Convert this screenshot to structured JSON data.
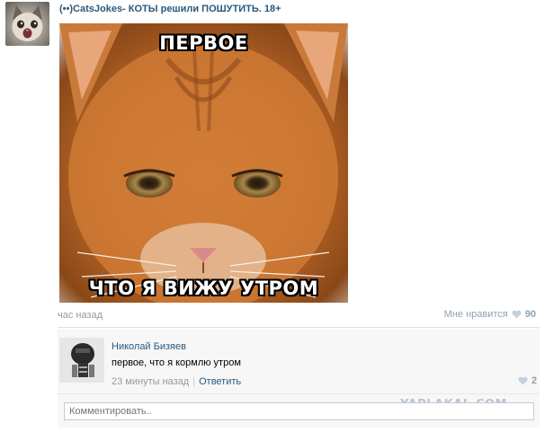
{
  "post": {
    "title": "(••)CatsJokes- КОТЫ решили ПОШУТИТЬ. 18+",
    "meme_top": "ПЕРВОЕ",
    "meme_bottom": "ЧТО Я ВИЖУ УТРОМ",
    "time": "час назад",
    "like_label": "Мне нравится",
    "like_count": "90"
  },
  "comment": {
    "author": "Николай Бизяев",
    "text": "первое, что я кормлю утром",
    "time": "23 минуты назад",
    "reply_label": "Ответить",
    "like_count": "2"
  },
  "comment_input": {
    "placeholder": "Комментировать.."
  },
  "watermark": "YAPLAKAL.COM",
  "icons": {
    "heart": "heart-icon"
  },
  "colors": {
    "link": "#2b587a",
    "muted": "#999999",
    "like": "#8fa1b3"
  }
}
